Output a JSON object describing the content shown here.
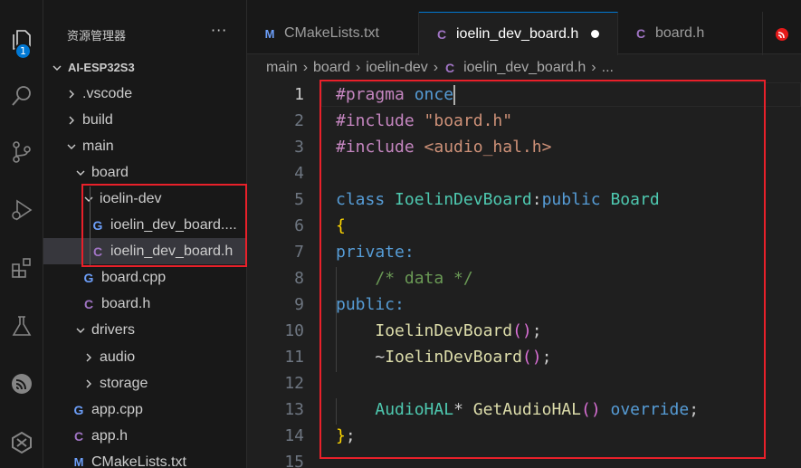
{
  "activity_bar": {
    "explorer_badge": "1",
    "icons": [
      "files-icon",
      "search-icon",
      "source-control-icon",
      "run-debug-icon",
      "extensions-icon",
      "testing-icon",
      "espressif-icon",
      "idf-icon"
    ]
  },
  "sidebar": {
    "title": "资源管理器",
    "more": "···",
    "tree": [
      {
        "label": "AI-ESP32S3",
        "type": "root",
        "chevron": "down"
      },
      {
        "label": ".vscode",
        "type": "folder",
        "chevron": "right"
      },
      {
        "label": "build",
        "type": "folder",
        "chevron": "right"
      },
      {
        "label": "main",
        "type": "folder",
        "chevron": "down"
      },
      {
        "label": "board",
        "type": "folder",
        "chevron": "down"
      },
      {
        "label": "ioelin-dev",
        "type": "folder",
        "chevron": "down"
      },
      {
        "label": "ioelin_dev_board....",
        "type": "cpp"
      },
      {
        "label": "ioelin_dev_board.h",
        "type": "h"
      },
      {
        "label": "board.cpp",
        "type": "cpp"
      },
      {
        "label": "board.h",
        "type": "h"
      },
      {
        "label": "drivers",
        "type": "folder",
        "chevron": "down"
      },
      {
        "label": "audio",
        "type": "folder",
        "chevron": "right"
      },
      {
        "label": "storage",
        "type": "folder",
        "chevron": "right"
      },
      {
        "label": "app.cpp",
        "type": "cpp"
      },
      {
        "label": "app.h",
        "type": "h"
      },
      {
        "label": "CMakeLists.txt",
        "type": "cmake"
      }
    ]
  },
  "tabs": [
    {
      "label": "CMakeLists.txt",
      "icon": "M"
    },
    {
      "label": "ioelin_dev_board.h",
      "icon": "C",
      "active": true,
      "modified": true
    },
    {
      "label": "board.h",
      "icon": "C"
    }
  ],
  "breadcrumb": {
    "items": [
      "main",
      "board",
      "ioelin-dev"
    ],
    "file_icon": "C",
    "file": "ioelin_dev_board.h",
    "tail": "..."
  },
  "file_icons": {
    "cpp": "G",
    "h": "C",
    "cmake": "M"
  },
  "colors": {
    "accent": "#0078d4",
    "highlight_box": "#e8202a",
    "cpp_icon": "#6c9ef8",
    "h_icon": "#a074c4"
  },
  "editor": {
    "active_line": 1,
    "lines": [
      {
        "n": "1"
      },
      {
        "n": "2"
      },
      {
        "n": "3"
      },
      {
        "n": "4"
      },
      {
        "n": "5"
      },
      {
        "n": "6"
      },
      {
        "n": "7"
      },
      {
        "n": "8"
      },
      {
        "n": "9"
      },
      {
        "n": "10"
      },
      {
        "n": "11"
      },
      {
        "n": "12"
      },
      {
        "n": "13"
      },
      {
        "n": "14"
      },
      {
        "n": "15"
      }
    ],
    "tokens": {
      "l1": [
        "#pragma",
        " ",
        "once"
      ],
      "l2": [
        "#include",
        " ",
        "\"board.h\""
      ],
      "l3": [
        "#include",
        " ",
        "<audio_hal.h>"
      ],
      "l5": [
        "class",
        " ",
        "IoelinDevBoard",
        ":",
        "public",
        " ",
        "Board"
      ],
      "l6": [
        "{"
      ],
      "l7": [
        "private:"
      ],
      "l8": [
        "    ",
        "/* data */"
      ],
      "l9": [
        "public:"
      ],
      "l10": [
        "    ",
        "IoelinDevBoard",
        "(",
        ")",
        ";"
      ],
      "l11": [
        "    ",
        "~",
        "IoelinDevBoard",
        "(",
        ")",
        ";"
      ],
      "l13": [
        "    ",
        "AudioHAL",
        "*",
        " ",
        "GetAudioHAL",
        "(",
        ")",
        " ",
        "override",
        ";"
      ],
      "l14": [
        "}",
        ";"
      ]
    }
  }
}
